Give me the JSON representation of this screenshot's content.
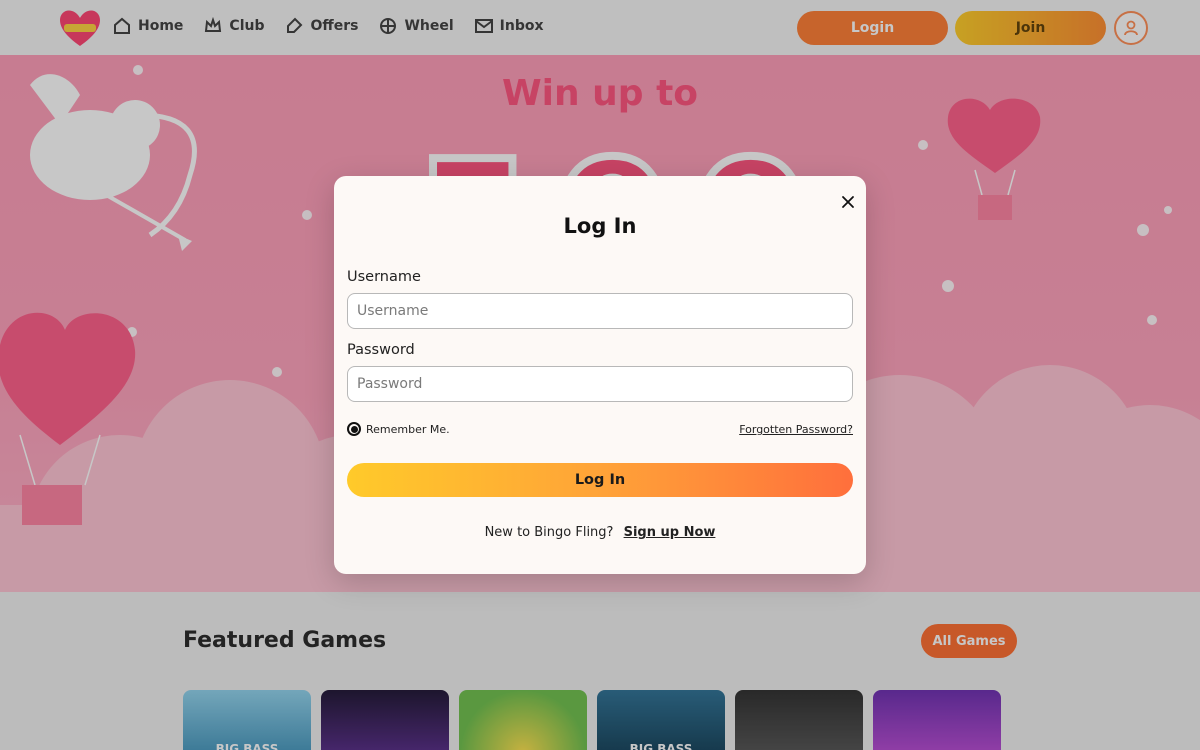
{
  "nav": {
    "items": [
      {
        "label": "Home",
        "icon": "home-icon"
      },
      {
        "label": "Club",
        "icon": "crown-icon"
      },
      {
        "label": "Offers",
        "icon": "tag-icon"
      },
      {
        "label": "Wheel",
        "icon": "wheel-icon"
      },
      {
        "label": "Inbox",
        "icon": "mail-icon"
      }
    ],
    "login_label": "Login",
    "join_label": "Join"
  },
  "hero": {
    "headline": "Win up to",
    "big_number_partial": "500"
  },
  "featured": {
    "title": "Featured Games",
    "all_games_label": "All Games",
    "games": [
      {
        "label": "BIG BASS",
        "color": "#4aa7c9"
      },
      {
        "label": "",
        "color": "#2a1a4a"
      },
      {
        "label": "",
        "color": "#7cc24a"
      },
      {
        "label": "BIG BASS",
        "color": "#1f6e8a"
      },
      {
        "label": "",
        "color": "#3a3a3a"
      },
      {
        "label": "",
        "color": "#7a3ab8"
      }
    ]
  },
  "modal": {
    "title": "Log In",
    "username_label": "Username",
    "username_placeholder": "Username",
    "password_label": "Password",
    "password_placeholder": "Password",
    "remember_label": "Remember Me.",
    "forgot_label": "Forgotten Password?",
    "submit_label": "Log In",
    "signup_prompt": "New to Bingo Fling?",
    "signup_link": "Sign up Now"
  },
  "colors": {
    "accent_orange": "#ff7a2e",
    "accent_yellow": "#ffca2a",
    "hero_pink": "#ff9ab6"
  }
}
